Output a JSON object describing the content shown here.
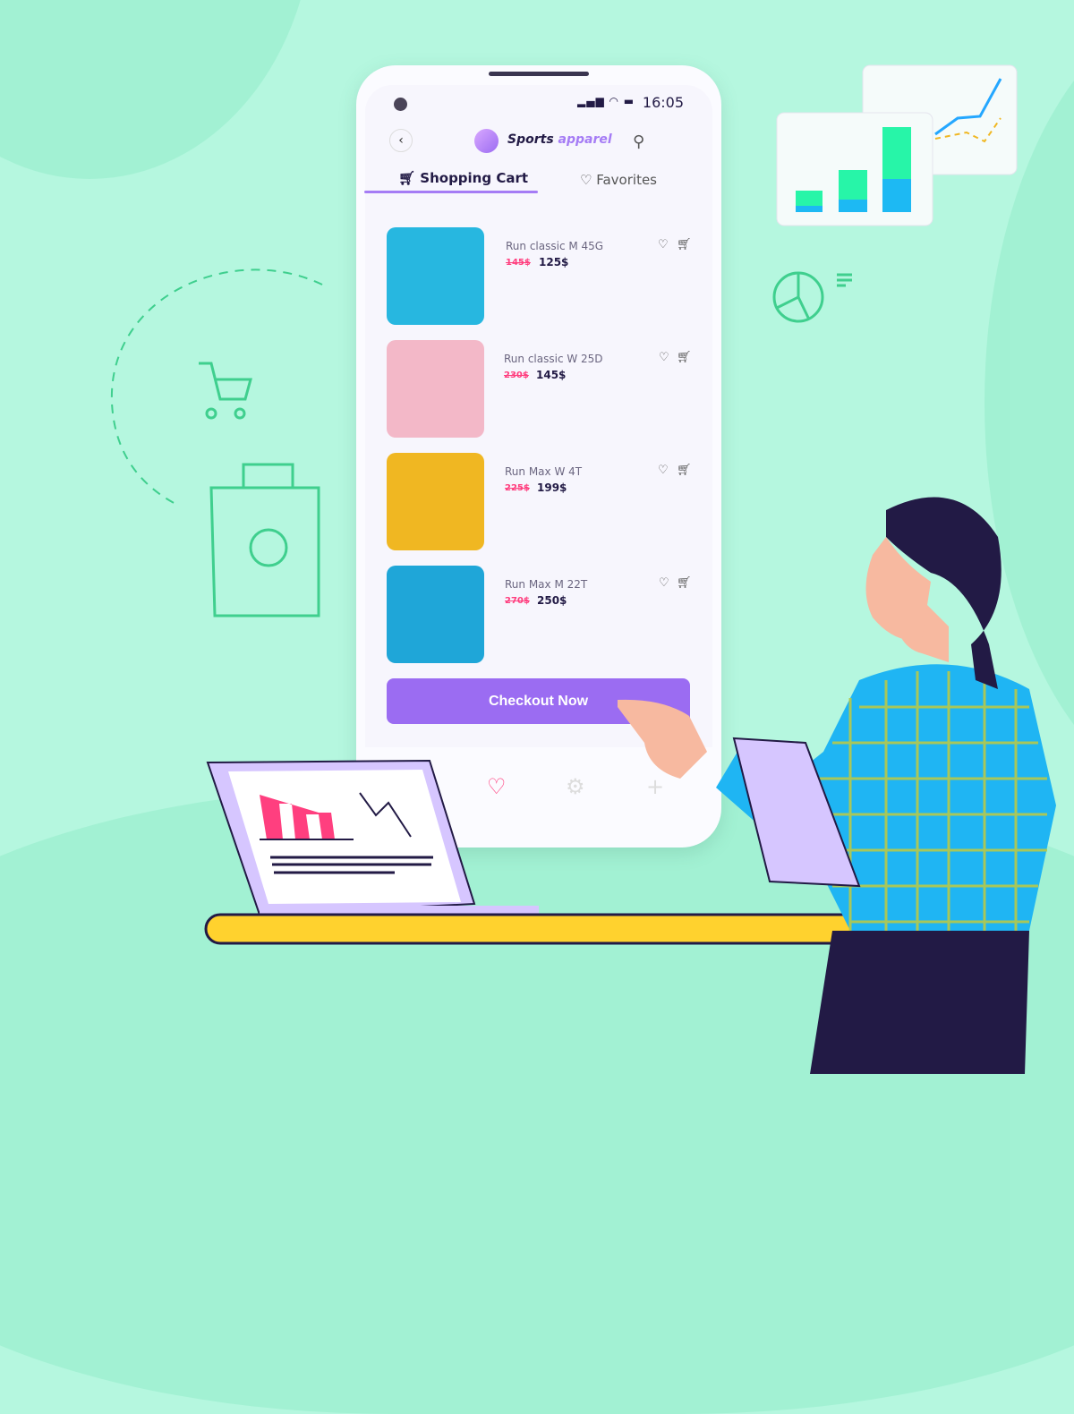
{
  "status_bar": {
    "time": "16:05"
  },
  "header": {
    "brand_main": "Sports",
    "brand_accent": "apparel"
  },
  "tabs": [
    {
      "label": "Shopping Cart",
      "active": true
    },
    {
      "label": "Favorites",
      "active": false
    }
  ],
  "products": [
    {
      "name": "Run classic M 45G",
      "old_price": "145$",
      "price": "125$",
      "image_color": "#27b7e0"
    },
    {
      "name": "Run classic W 25D",
      "old_price": "230$",
      "price": "145$",
      "image_color": "#f3b8c8"
    },
    {
      "name": "Run Max W 4T",
      "old_price": "225$",
      "price": "199$",
      "image_color": "#f0b722"
    },
    {
      "name": "Run Max M 22T",
      "old_price": "270$",
      "price": "250$",
      "image_color": "#1fa6d8"
    }
  ],
  "checkout": {
    "label": "Checkout Now"
  },
  "colors": {
    "accent": "#9b6cf2",
    "old_price": "#ff3f7f",
    "background": "#b5f7df"
  }
}
